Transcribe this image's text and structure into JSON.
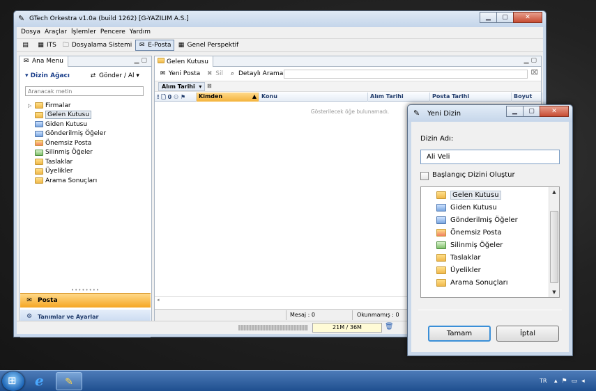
{
  "window": {
    "title": "GTech Orkestra v1.0a (build 1262) [G-YAZILIM A.S.]",
    "controls": [
      "▁",
      "▢",
      "✕"
    ]
  },
  "menu": [
    "Dosya",
    "Araçlar",
    "İşlemler",
    "Pencere",
    "Yardım"
  ],
  "toolbar": {
    "its": "ITS",
    "dosyalama": "Dosyalama Sistemi",
    "eposta": "E-Posta",
    "genel": "Genel Perspektif"
  },
  "left_panel": {
    "tab": "Ana Menu",
    "tree_header": "Dizin Ağacı",
    "send_receive": "Gönder / Al",
    "search_placeholder": "Aranacak metin",
    "folders": [
      "Firmalar",
      "Gelen Kutusu",
      "Giden Kutusu",
      "Gönderilmiş Öğeler",
      "Önemsiz Posta",
      "Silinmiş Öğeler",
      "Taslaklar",
      "Üyelikler",
      "Arama Sonuçları"
    ],
    "nav_posta": "Posta",
    "nav_tanim": "Tanımlar ve Ayarlar"
  },
  "right_panel": {
    "tab": "Gelen Kutusu",
    "new_mail": "Yeni Posta",
    "delete": "Sil",
    "detailed_search": "Detaylı Arama",
    "group_by": "Alım Tarihi",
    "columns": [
      "Kimden",
      "Konu",
      "Alım Tarihi",
      "Posta Tarihi",
      "Boyut"
    ],
    "empty_message": "Gösterilecek öğe bulunamadı.",
    "status_mesaj": "Mesaj : 0",
    "status_okunmamis": "Okunmamış : 0"
  },
  "statusbar": {
    "memory": "21M / 36M"
  },
  "dialog": {
    "title": "Yeni Dizin",
    "name_label": "Dizin Adı:",
    "name_value": "Ali Veli",
    "checkbox_label": "Başlangıç Dizini Oluştur",
    "folders": [
      "Gelen Kutusu",
      "Giden Kutusu",
      "Gönderilmiş Öğeler",
      "Önemsiz Posta",
      "Silinmiş Öğeler",
      "Taslaklar",
      "Üyelikler",
      "Arama Sonuçları"
    ],
    "ok": "Tamam",
    "cancel": "İptal"
  },
  "taskbar": {
    "lang": "TR"
  }
}
